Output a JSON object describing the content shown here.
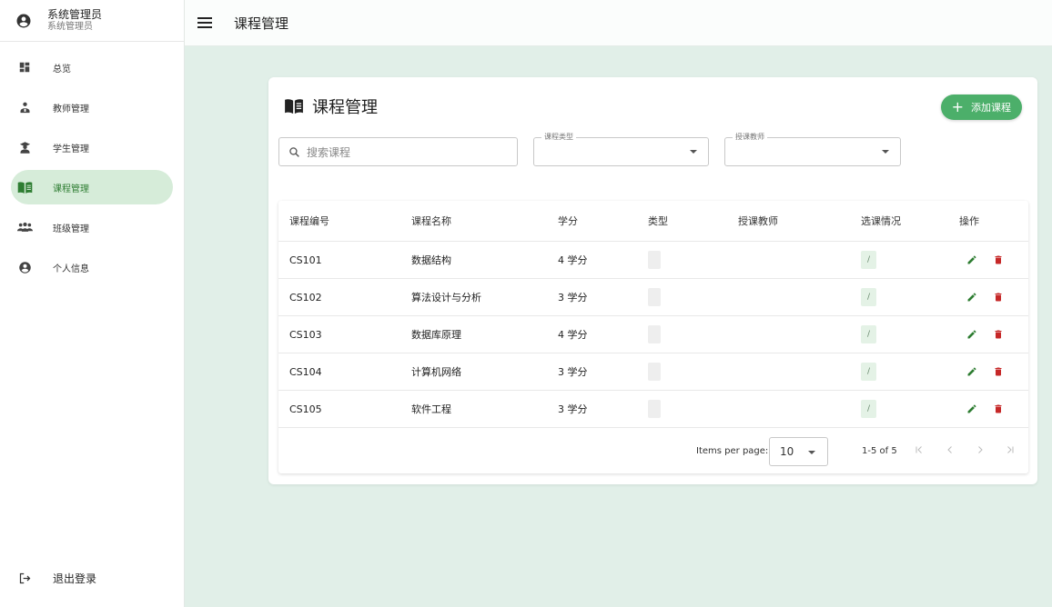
{
  "user": {
    "name": "系统管理员",
    "role": "系统管理员"
  },
  "nav": {
    "items": [
      {
        "label": "总览"
      },
      {
        "label": "教师管理"
      },
      {
        "label": "学生管理"
      },
      {
        "label": "课程管理"
      },
      {
        "label": "班级管理"
      },
      {
        "label": "个人信息"
      }
    ],
    "logout": "退出登录"
  },
  "topbar": {
    "title": "课程管理"
  },
  "card": {
    "title": "课程管理",
    "add_button": "添加课程",
    "search_placeholder": "搜索课程",
    "filter_type_label": "课程类型",
    "filter_teacher_label": "授课教师"
  },
  "table": {
    "headers": [
      "课程编号",
      "课程名称",
      "学分",
      "类型",
      "授课教师",
      "选课情况",
      "操作"
    ],
    "rows": [
      {
        "code": "CS101",
        "name": "数据结构",
        "credits": "4 学分",
        "enroll": "/"
      },
      {
        "code": "CS102",
        "name": "算法设计与分析",
        "credits": "3 学分",
        "enroll": "/"
      },
      {
        "code": "CS103",
        "name": "数据库原理",
        "credits": "4 学分",
        "enroll": "/"
      },
      {
        "code": "CS104",
        "name": "计算机网络",
        "credits": "3 学分",
        "enroll": "/"
      },
      {
        "code": "CS105",
        "name": "软件工程",
        "credits": "3 学分",
        "enroll": "/"
      }
    ]
  },
  "pager": {
    "items_per_page_label": "Items per page:",
    "page_size": "10",
    "range": "1-5 of 5"
  },
  "colors": {
    "accent": "#4caf6a",
    "active_bg": "#d6ecd9",
    "main_bg": "#e1efe8",
    "delete": "#c62828",
    "edit": "#2e7d32"
  }
}
